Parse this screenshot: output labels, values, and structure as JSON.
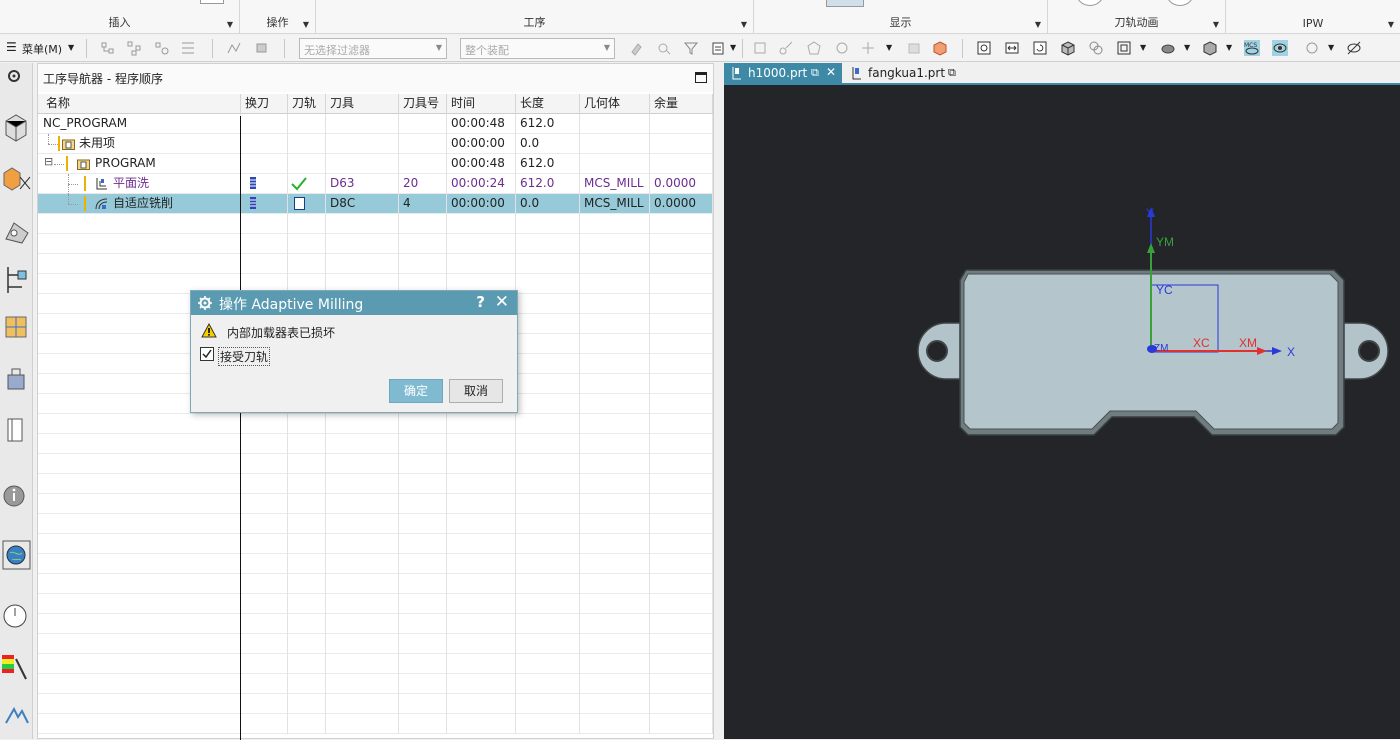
{
  "ribbon": {
    "groups": [
      "插入",
      "操作",
      "工序",
      "显示",
      "刀轨动画",
      "IPW"
    ]
  },
  "toolbar": {
    "menu_label": "菜单(M)",
    "filter_placeholder": "无选择过滤器",
    "assembly_placeholder": "整个装配"
  },
  "navigator": {
    "title": "工序导航器 - 程序顺序",
    "columns": [
      "名称",
      "换刀",
      "刀轨",
      "刀具",
      "刀具号",
      "时间",
      "长度",
      "几何体",
      "余量"
    ],
    "rows": [
      {
        "name": "NC_PROGRAM",
        "tool": "",
        "tool_no": "",
        "time": "00:00:48",
        "length": "612.0",
        "geometry": "",
        "stock": ""
      },
      {
        "name": "未用项",
        "tool": "",
        "tool_no": "",
        "time": "00:00:00",
        "length": "0.0",
        "geometry": "",
        "stock": ""
      },
      {
        "name": "PROGRAM",
        "tool": "",
        "tool_no": "",
        "time": "00:00:48",
        "length": "612.0",
        "geometry": "",
        "stock": ""
      },
      {
        "name": "平面洗",
        "tool": "D63",
        "tool_no": "20",
        "time": "00:00:24",
        "length": "612.0",
        "geometry": "MCS_MILL",
        "stock": "0.0000"
      },
      {
        "name": "自适应铣削",
        "tool": "D8C",
        "tool_no": "4",
        "time": "00:00:00",
        "length": "0.0",
        "geometry": "MCS_MILL",
        "stock": "0.0000"
      }
    ]
  },
  "dialog": {
    "title": "操作  Adaptive Milling",
    "help": "?",
    "close": "✕",
    "message": "内部加载器表已损坏",
    "checkbox_label": "接受刀轨",
    "checkbox_checked": true,
    "ok": "确定",
    "cancel": "取消"
  },
  "graphics": {
    "tabs": [
      {
        "label": "h1000.prt",
        "active": true
      },
      {
        "label": "fangkua1.prt",
        "active": false
      }
    ],
    "axes": {
      "ym": "YM",
      "yc": "YC",
      "xc": "XC",
      "xm": "XM",
      "x": "X",
      "zm": "ZM",
      "y": "Y"
    },
    "colors": {
      "background": "#232528",
      "part": "#b4c6cc",
      "xm": "#e03030",
      "ym": "#3aa03a",
      "wcs": "#2a3ad8"
    }
  }
}
